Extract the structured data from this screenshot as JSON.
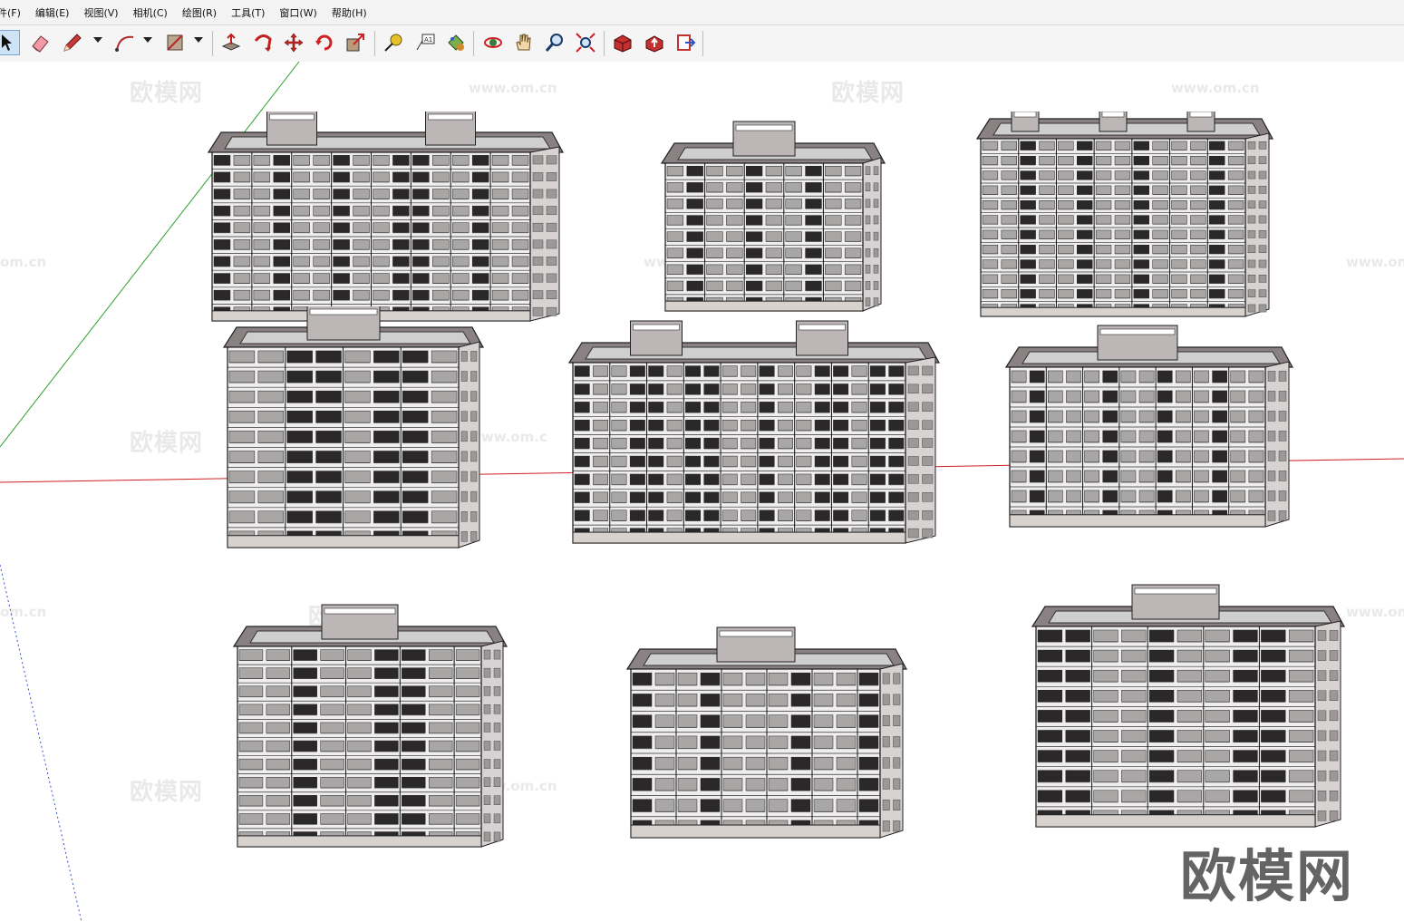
{
  "menu": [
    {
      "id": "file",
      "label": "件(F)"
    },
    {
      "id": "edit",
      "label": "编辑(E)"
    },
    {
      "id": "view",
      "label": "视图(V)"
    },
    {
      "id": "camera",
      "label": "相机(C)"
    },
    {
      "id": "draw",
      "label": "绘图(R)"
    },
    {
      "id": "tools",
      "label": "工具(T)"
    },
    {
      "id": "window",
      "label": "窗口(W)"
    },
    {
      "id": "help",
      "label": "帮助(H)"
    }
  ],
  "toolbar_tools": [
    "select",
    "eraser",
    "pencil-line",
    "arc",
    "rectangle",
    "push-pull",
    "follow-me",
    "move",
    "rotate",
    "scale",
    "tape-measure",
    "text",
    "paint-bucket",
    "orbit",
    "pan",
    "zoom",
    "zoom-extents",
    "warehouse",
    "share-model",
    "send-to-layout"
  ],
  "viewport": {
    "axis_colors": {
      "red": "#d02020",
      "green": "#2ca02c",
      "blue": "#3050d0"
    },
    "watermark_cn": "欧模网",
    "watermark_url": "www.om.cn",
    "watermark_url_partial_left": "om.cn",
    "watermark_url_partial_mid": "www.om.c",
    "watermark_cn_partial_left": "om.cn",
    "brand_logo": "欧模网",
    "buildings": [
      {
        "name": "twin-tower-slab"
      },
      {
        "name": "crowned-tower"
      },
      {
        "name": "tall-slab"
      },
      {
        "name": "balcony-tower"
      },
      {
        "name": "long-twin-tower"
      },
      {
        "name": "rooftop-terrace-tower"
      },
      {
        "name": "cross-roof-tower"
      },
      {
        "name": "colonnade-tower"
      },
      {
        "name": "stepped-crown-tower"
      }
    ]
  }
}
